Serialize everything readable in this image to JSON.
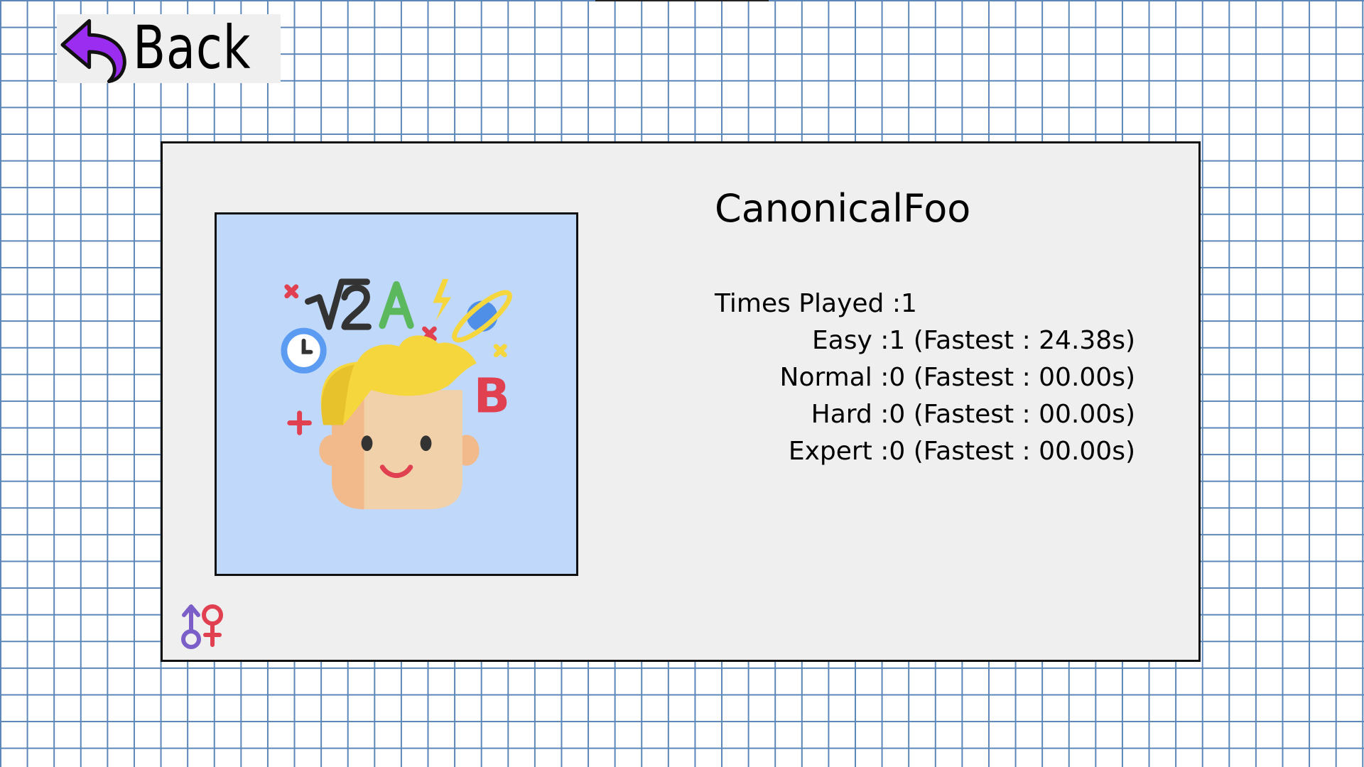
{
  "back_button": {
    "label": "Back",
    "icon": "back-arrow-icon",
    "icon_color": "#9b2df0"
  },
  "profile": {
    "username": "CanonicalFoo",
    "avatar_icon": "thinking-boy-avatar-icon",
    "gender_icon": "gender-symbol-icon",
    "times_played_label": "Times Played :",
    "times_played": "1",
    "difficulties": [
      {
        "name": "Easy",
        "text": "Easy :1 (Fastest : 24.38s)"
      },
      {
        "name": "Normal",
        "text": "Normal :0 (Fastest : 00.00s)"
      },
      {
        "name": "Hard",
        "text": "Hard :0 (Fastest : 00.00s)"
      },
      {
        "name": "Expert",
        "text": "Expert :0 (Fastest : 00.00s)"
      }
    ]
  },
  "colors": {
    "grid": "#5b86b8",
    "card_bg": "#efefef",
    "avatar_bg": "#c0d9fb"
  }
}
